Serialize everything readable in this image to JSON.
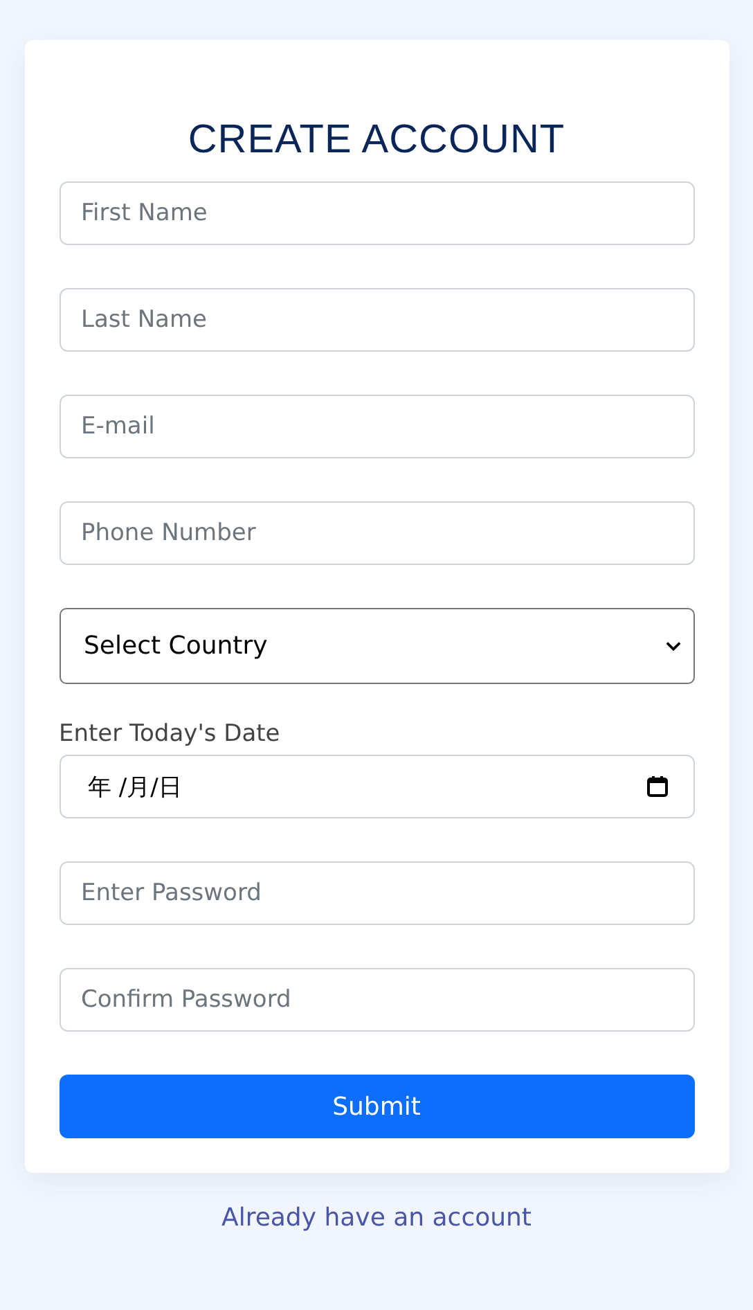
{
  "title": "CREATE ACCOUNT",
  "fields": [
    {
      "kind": "text",
      "placeholder": "First Name"
    },
    {
      "kind": "text",
      "placeholder": "Last Name"
    },
    {
      "kind": "text",
      "placeholder": "E-mail"
    },
    {
      "kind": "text",
      "placeholder": "Phone Number"
    },
    {
      "kind": "select",
      "value": "Select Country"
    },
    {
      "kind": "date",
      "label": "Enter Today's Date",
      "value": "年 /月/日"
    },
    {
      "kind": "text",
      "placeholder": "Enter Password"
    },
    {
      "kind": "text",
      "placeholder": "Confirm Password"
    }
  ],
  "submit_button": "Submit",
  "login_link": "Already have an account"
}
